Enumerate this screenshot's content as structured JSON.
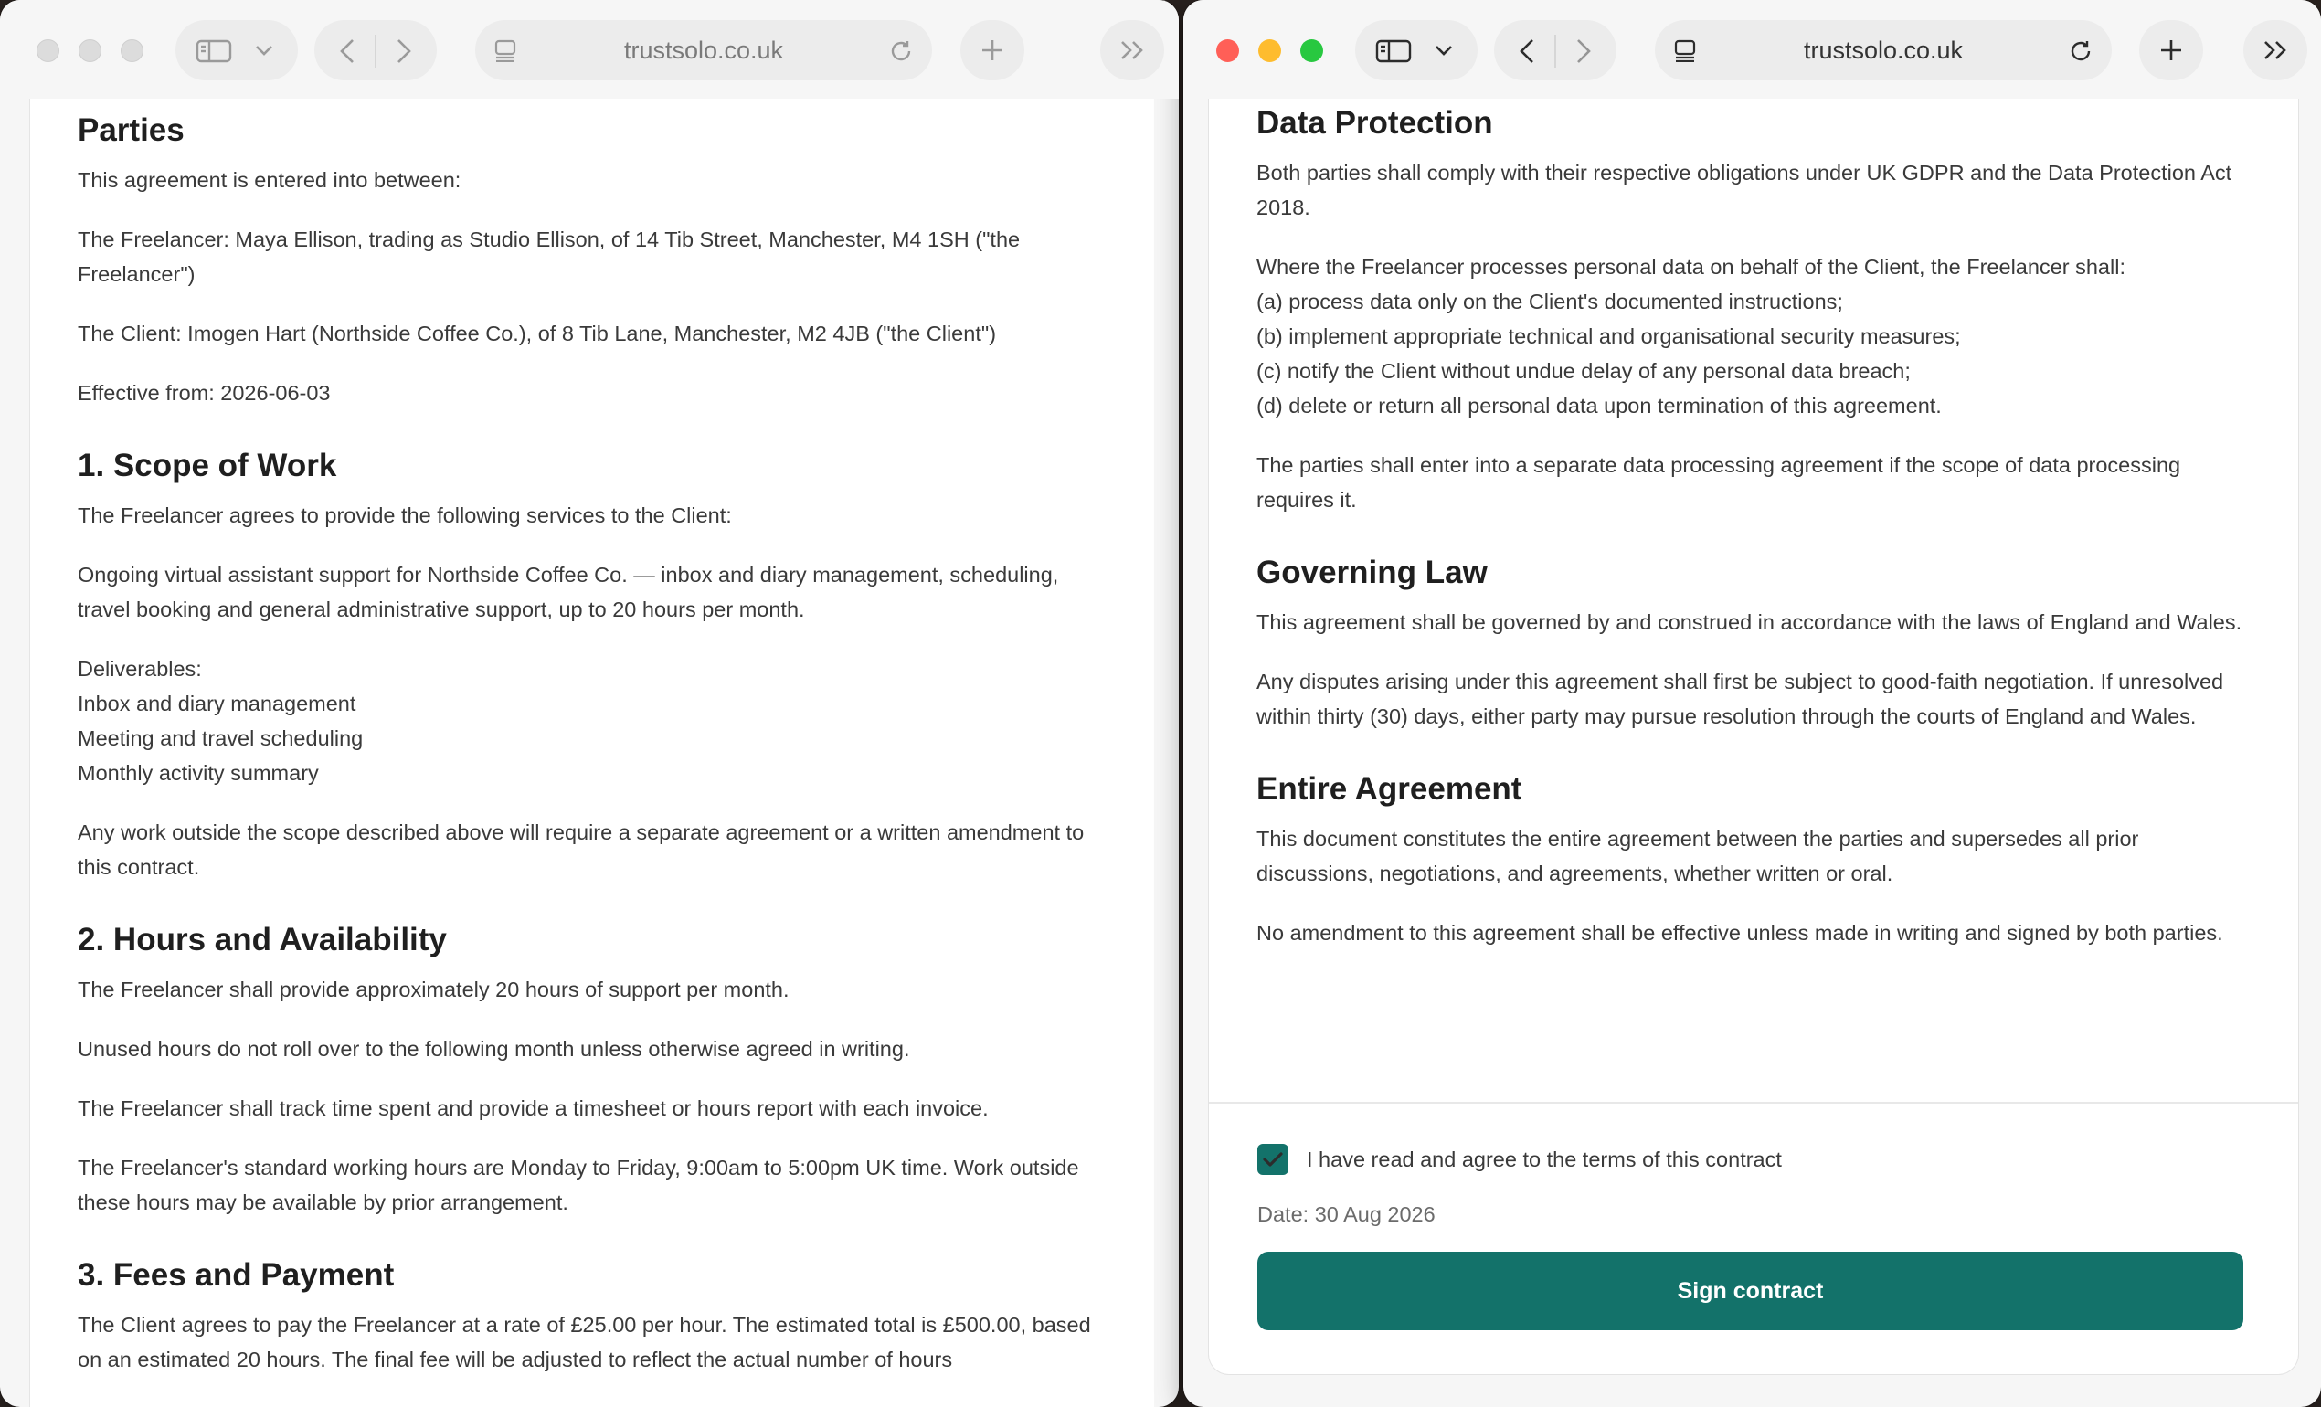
{
  "left_window": {
    "url": "trustsolo.co.uk",
    "sections": {
      "parties": {
        "heading": "Parties",
        "intro": "This agreement is entered into between:",
        "freelancer": "The Freelancer: Maya Ellison, trading as Studio Ellison, of 14 Tib Street, Manchester, M4 1SH (\"the Freelancer\")",
        "client": "The Client: Imogen Hart (Northside Coffee Co.), of 8 Tib Lane, Manchester, M2 4JB (\"the Client\")",
        "effective": "Effective from: 2026-06-03"
      },
      "scope": {
        "heading": "1. Scope of Work",
        "intro": "The Freelancer agrees to provide the following services to the Client:",
        "description": "Ongoing virtual assistant support for Northside Coffee Co. — inbox and diary management, scheduling, travel booking and general administrative support, up to 20 hours per month.",
        "deliverables_label": "Deliverables:",
        "deliverables": [
          "Inbox and diary management",
          "Meeting and travel scheduling",
          "Monthly activity summary"
        ],
        "outside_scope": "Any work outside the scope described above will require a separate agreement or a written amendment to this contract."
      },
      "hours": {
        "heading": "2. Hours and Availability",
        "p1": "The Freelancer shall provide approximately 20 hours of support per month.",
        "p2": "Unused hours do not roll over to the following month unless otherwise agreed in writing.",
        "p3": "The Freelancer shall track time spent and provide a timesheet or hours report with each invoice.",
        "p4": "The Freelancer's standard working hours are Monday to Friday, 9:00am to 5:00pm UK time. Work outside these hours may be available by prior arrangement."
      },
      "fees": {
        "heading": "3. Fees and Payment",
        "p1": "The Client agrees to pay the Freelancer at a rate of £25.00 per hour. The estimated total is £500.00, based on an estimated 20 hours. The final fee will be adjusted to reflect the actual number of hours"
      }
    }
  },
  "right_window": {
    "url": "trustsolo.co.uk",
    "sections": {
      "data_protection": {
        "heading": "Data Protection",
        "p1": "Both parties shall comply with their respective obligations under UK GDPR and the Data Protection Act 2018.",
        "p2_intro": "Where the Freelancer processes personal data on behalf of the Client, the Freelancer shall:",
        "clauses": [
          "(a) process data only on the Client's documented instructions;",
          "(b) implement appropriate technical and organisational security measures;",
          "(c) notify the Client without undue delay of any personal data breach;",
          "(d) delete or return all personal data upon termination of this agreement."
        ],
        "p3": "The parties shall enter into a separate data processing agreement if the scope of data processing requires it."
      },
      "governing_law": {
        "heading": "Governing Law",
        "p1": "This agreement shall be governed by and construed in accordance with the laws of England and Wales.",
        "p2": "Any disputes arising under this agreement shall first be subject to good-faith negotiation. If unresolved within thirty (30) days, either party may pursue resolution through the courts of England and Wales."
      },
      "entire_agreement": {
        "heading": "Entire Agreement",
        "p1": "This document constitutes the entire agreement between the parties and supersedes all prior discussions, negotiations, and agreements, whether written or oral.",
        "p2": "No amendment to this agreement shall be effective unless made in writing and signed by both parties."
      }
    },
    "consent_label": "I have read and agree to the terms of this contract",
    "consent_checked": true,
    "date_text": "Date: 30 Aug 2026",
    "sign_button": "Sign contract"
  },
  "colors": {
    "accent": "#13726a",
    "close": "#ff5f57",
    "minimize": "#febc2e",
    "zoom": "#28c840"
  }
}
